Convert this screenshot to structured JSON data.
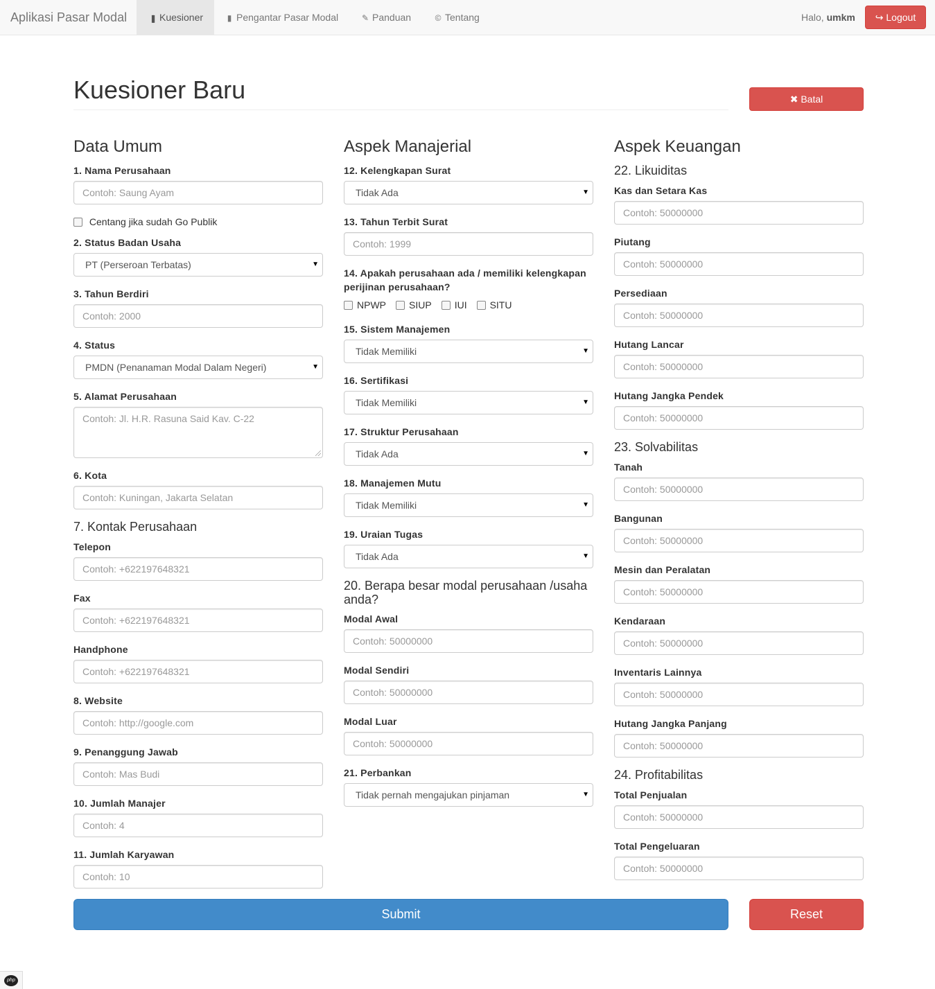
{
  "navbar": {
    "brand": "Aplikasi Pasar Modal",
    "items": [
      {
        "label": "Kuesioner",
        "icon": "bar-chart-icon",
        "glyph": "▐▌"
      },
      {
        "label": "Pengantar Pasar Modal",
        "icon": "book-icon",
        "glyph": "▮"
      },
      {
        "label": "Panduan",
        "icon": "pencil-icon",
        "glyph": "✎"
      },
      {
        "label": "Tentang",
        "icon": "copyright-icon",
        "glyph": "©"
      }
    ],
    "greeting_prefix": "Halo, ",
    "username": "umkm",
    "logout_label": "Logout",
    "logout_icon": "logout-icon",
    "logout_glyph": "↪"
  },
  "header": {
    "title": "Kuesioner Baru",
    "cancel_label": "Batal",
    "cancel_glyph": "✖"
  },
  "data_umum": {
    "heading": "Data Umum",
    "nama_label": "1. Nama Perusahaan",
    "nama_placeholder": "Contoh: Saung Ayam",
    "go_publik_label": "Centang jika sudah Go Publik",
    "status_badan_label": "2. Status Badan Usaha",
    "status_badan_value": "PT (Perseroan Terbatas)",
    "tahun_berdiri_label": "3. Tahun Berdiri",
    "tahun_berdiri_placeholder": "Contoh: 2000",
    "status_label": "4. Status",
    "status_value": "PMDN (Penanaman Modal Dalam Negeri)",
    "alamat_label": "5. Alamat Perusahaan",
    "alamat_placeholder": "Contoh: Jl. H.R. Rasuna Said Kav. C-22",
    "kota_label": "6. Kota",
    "kota_placeholder": "Contoh: Kuningan, Jakarta Selatan",
    "kontak_heading": "7. Kontak Perusahaan",
    "telepon_label": "Telepon",
    "telepon_placeholder": "Contoh: +622197648321",
    "fax_label": "Fax",
    "fax_placeholder": "Contoh: +622197648321",
    "handphone_label": "Handphone",
    "handphone_placeholder": "Contoh: +622197648321",
    "website_label": "8. Website",
    "website_placeholder": "Contoh: http://google.com",
    "penanggung_label": "9. Penanggung Jawab",
    "penanggung_placeholder": "Contoh: Mas Budi",
    "manajer_label": "10. Jumlah Manajer",
    "manajer_placeholder": "Contoh: 4",
    "karyawan_label": "11. Jumlah Karyawan",
    "karyawan_placeholder": "Contoh: 10"
  },
  "manajerial": {
    "heading": "Aspek Manajerial",
    "surat_label": "12. Kelengkapan Surat",
    "surat_value": "Tidak Ada",
    "tahun_surat_label": "13. Tahun Terbit Surat",
    "tahun_surat_placeholder": "Contoh: 1999",
    "perijinan_label": "14. Apakah perusahaan ada / memiliki kelengkapan perijinan perusahaan?",
    "perijinan_options": [
      "NPWP",
      "SIUP",
      "IUI",
      "SITU"
    ],
    "sistem_label": "15. Sistem Manajemen",
    "sistem_value": "Tidak Memiliki",
    "sertifikasi_label": "16. Sertifikasi",
    "sertifikasi_value": "Tidak Memiliki",
    "struktur_label": "17. Struktur Perusahaan",
    "struktur_value": "Tidak Ada",
    "mutu_label": "18. Manajemen Mutu",
    "mutu_value": "Tidak Memiliki",
    "uraian_label": "19. Uraian Tugas",
    "uraian_value": "Tidak Ada",
    "modal_heading": "20. Berapa besar modal perusahaan /usaha anda?",
    "modal_awal_label": "Modal Awal",
    "modal_awal_placeholder": "Contoh: 50000000",
    "modal_sendiri_label": "Modal Sendiri",
    "modal_sendiri_placeholder": "Contoh: 50000000",
    "modal_luar_label": "Modal Luar",
    "modal_luar_placeholder": "Contoh: 50000000",
    "perbankan_label": "21. Perbankan",
    "perbankan_value": "Tidak pernah mengajukan pinjaman"
  },
  "keuangan": {
    "heading": "Aspek Keuangan",
    "likuiditas_heading": "22. Likuiditas",
    "kas_label": "Kas dan Setara Kas",
    "kas_placeholder": "Contoh: 50000000",
    "piutang_label": "Piutang",
    "piutang_placeholder": "Contoh: 50000000",
    "persediaan_label": "Persediaan",
    "persediaan_placeholder": "Contoh: 50000000",
    "hutang_lancar_label": "Hutang Lancar",
    "hutang_lancar_placeholder": "Contoh: 50000000",
    "hutang_pendek_label": "Hutang Jangka Pendek",
    "hutang_pendek_placeholder": "Contoh: 50000000",
    "solvabilitas_heading": "23. Solvabilitas",
    "tanah_label": "Tanah",
    "tanah_placeholder": "Contoh: 50000000",
    "bangunan_label": "Bangunan",
    "bangunan_placeholder": "Contoh: 50000000",
    "mesin_label": "Mesin dan Peralatan",
    "mesin_placeholder": "Contoh: 50000000",
    "kendaraan_label": "Kendaraan",
    "kendaraan_placeholder": "Contoh: 50000000",
    "inventaris_label": "Inventaris Lainnya",
    "inventaris_placeholder": "Contoh: 50000000",
    "hutang_panjang_label": "Hutang Jangka Panjang",
    "hutang_panjang_placeholder": "Contoh: 50000000",
    "profitabilitas_heading": "24. Profitabilitas",
    "penjualan_label": "Total Penjualan",
    "penjualan_placeholder": "Contoh: 50000000",
    "pengeluaran_label": "Total Pengeluaran",
    "pengeluaran_placeholder": "Contoh: 50000000"
  },
  "actions": {
    "submit_label": "Submit",
    "reset_label": "Reset"
  },
  "footer": {
    "badge_text": "php",
    "badge_icon": "php-logo-icon"
  },
  "colors": {
    "primary": "#428bca",
    "danger": "#d9534f",
    "navbar_bg": "#f8f8f8"
  }
}
